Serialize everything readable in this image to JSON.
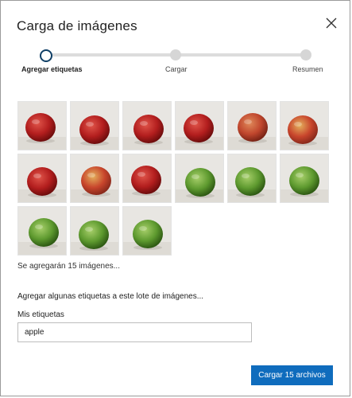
{
  "dialog": {
    "title": "Carga de imágenes"
  },
  "stepper": {
    "steps": [
      {
        "label": "Agregar etiquetas",
        "active": true
      },
      {
        "label": "Cargar",
        "active": false
      },
      {
        "label": "Resumen",
        "active": false
      }
    ]
  },
  "images": {
    "items": [
      {
        "type": "red"
      },
      {
        "type": "red"
      },
      {
        "type": "red"
      },
      {
        "type": "red"
      },
      {
        "type": "red-bruised"
      },
      {
        "type": "red-yellow"
      },
      {
        "type": "red"
      },
      {
        "type": "red-yellow"
      },
      {
        "type": "red"
      },
      {
        "type": "green"
      },
      {
        "type": "green"
      },
      {
        "type": "green"
      },
      {
        "type": "green"
      },
      {
        "type": "green"
      },
      {
        "type": "green"
      }
    ],
    "count_text": "Se agregarán 15 imágenes..."
  },
  "tags": {
    "heading": "Agregar algunas etiquetas a este lote de imágenes...",
    "label": "Mis etiquetas",
    "value": "apple"
  },
  "actions": {
    "submit_label": "Cargar 15 archivos"
  },
  "colors": {
    "accent": "#0f6cbd",
    "step_active": "#0f3f66",
    "track": "#dcdcdc"
  }
}
